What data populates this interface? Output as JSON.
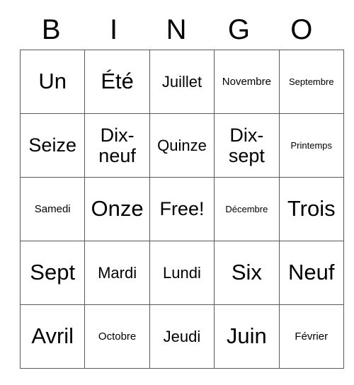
{
  "header": {
    "letters": [
      "B",
      "I",
      "N",
      "G",
      "O"
    ]
  },
  "grid": {
    "rows": [
      [
        {
          "text": "Un",
          "size": "sz-xl"
        },
        {
          "text": "Été",
          "size": "sz-xl"
        },
        {
          "text": "Juillet",
          "size": "sz-md"
        },
        {
          "text": "Novembre",
          "size": "sz-sm"
        },
        {
          "text": "Septembre",
          "size": "sz-xs"
        }
      ],
      [
        {
          "text": "Seize",
          "size": "sz-lg"
        },
        {
          "text": "Dix-neuf",
          "size": "sz-lg"
        },
        {
          "text": "Quinze",
          "size": "sz-md"
        },
        {
          "text": "Dix-sept",
          "size": "sz-lg"
        },
        {
          "text": "Printemps",
          "size": "sz-xs"
        }
      ],
      [
        {
          "text": "Samedi",
          "size": "sz-sm"
        },
        {
          "text": "Onze",
          "size": "sz-xl"
        },
        {
          "text": "Free!",
          "size": "sz-lg"
        },
        {
          "text": "Décembre",
          "size": "sz-xs"
        },
        {
          "text": "Trois",
          "size": "sz-xl"
        }
      ],
      [
        {
          "text": "Sept",
          "size": "sz-xl"
        },
        {
          "text": "Mardi",
          "size": "sz-md"
        },
        {
          "text": "Lundi",
          "size": "sz-md"
        },
        {
          "text": "Six",
          "size": "sz-xl"
        },
        {
          "text": "Neuf",
          "size": "sz-xl"
        }
      ],
      [
        {
          "text": "Avril",
          "size": "sz-xl"
        },
        {
          "text": "Octobre",
          "size": "sz-sm"
        },
        {
          "text": "Jeudi",
          "size": "sz-md"
        },
        {
          "text": "Juin",
          "size": "sz-xl"
        },
        {
          "text": "Février",
          "size": "sz-sm"
        }
      ]
    ],
    "free_space": {
      "row": 2,
      "col": 2,
      "label": "Free!"
    }
  },
  "colors": {
    "background": "#ffffff",
    "text": "#000000",
    "border": "#5a5a5a"
  }
}
